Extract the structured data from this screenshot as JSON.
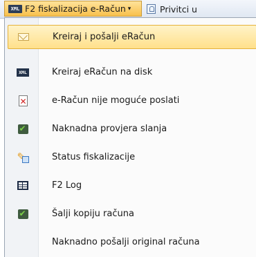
{
  "toolbar": {
    "active_menu": {
      "icon_text": "XML",
      "label": "F2 fiskalizacija e-Račun",
      "caret": "▾"
    },
    "next_button": {
      "label": "Privitci u"
    }
  },
  "menu": {
    "items": [
      {
        "label": "Kreiraj i pošalji eRačun",
        "icon": "envelope-icon",
        "highlighted": true
      },
      {
        "label": "Kreiraj eRačun na disk",
        "icon": "xml-file-icon",
        "icon_text": "XML"
      },
      {
        "label": "e-Račun nije moguće poslati",
        "icon": "document-error-icon"
      },
      {
        "label": "Naknadna provjera slanja",
        "icon": "check-icon"
      },
      {
        "label": "Status fiskalizacije",
        "icon": "status-edit-icon"
      },
      {
        "label": "F2 Log",
        "icon": "table-icon"
      },
      {
        "label": "Šalji kopiju računa",
        "icon": "check-icon"
      },
      {
        "label": "Naknadno pošalji original računa",
        "icon": ""
      }
    ]
  }
}
